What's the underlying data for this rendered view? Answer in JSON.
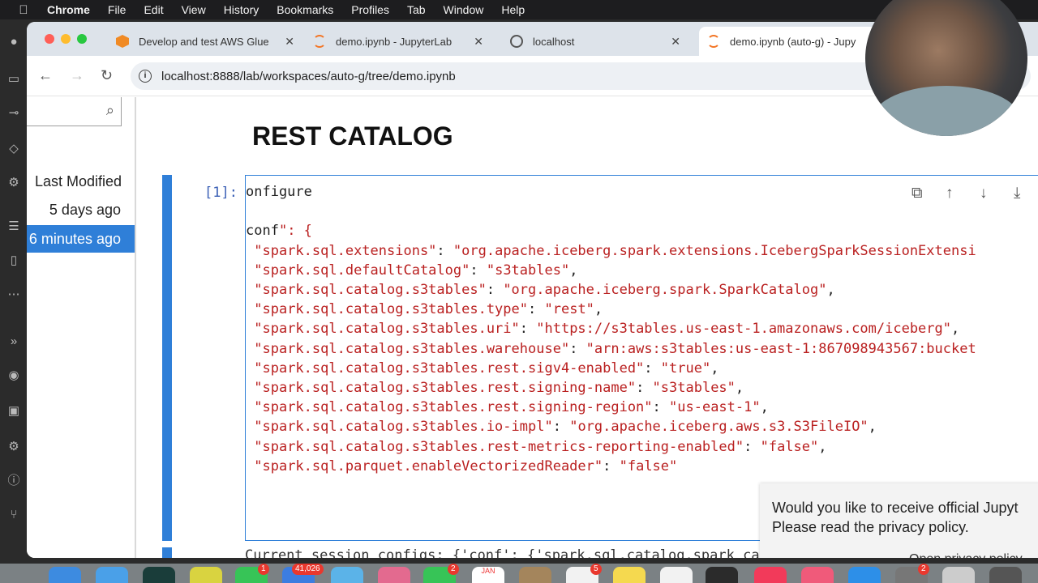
{
  "menubar": {
    "app_name": "Chrome",
    "items": [
      "File",
      "Edit",
      "View",
      "History",
      "Bookmarks",
      "Profiles",
      "Tab",
      "Window",
      "Help"
    ]
  },
  "browser": {
    "tabs": [
      {
        "title": "Develop and test AWS Glue",
        "icon": "aws-icon",
        "active": false
      },
      {
        "title": "demo.ipynb - JupyterLab",
        "icon": "jupyter-icon",
        "active": false
      },
      {
        "title": "localhost",
        "icon": "globe-icon",
        "active": false
      },
      {
        "title": "demo.ipynb (auto-g) - Jupy",
        "icon": "jupyter-icon",
        "active": true
      }
    ],
    "url": "localhost:8888/lab/workspaces/auto-g/tree/demo.ipynb"
  },
  "file_browser": {
    "column_header": "Last Modified",
    "rows": [
      {
        "modified": "5 days ago",
        "selected": false
      },
      {
        "modified": "6 minutes ago",
        "selected": true
      }
    ]
  },
  "notebook": {
    "markdown_title": "REST CATALOG",
    "cell_prompt": "[1]:",
    "code_lines": [
      "onfigure",
      "",
      "conf\": {",
      " \"spark.sql.extensions\": \"org.apache.iceberg.spark.extensions.IcebergSparkSessionExtensi",
      " \"spark.sql.defaultCatalog\": \"s3tables\",",
      " \"spark.sql.catalog.s3tables\": \"org.apache.iceberg.spark.SparkCatalog\",",
      " \"spark.sql.catalog.s3tables.type\": \"rest\",",
      " \"spark.sql.catalog.s3tables.uri\": \"https://s3tables.us-east-1.amazonaws.com/iceberg\",",
      " \"spark.sql.catalog.s3tables.warehouse\": \"arn:aws:s3tables:us-east-1:867098943567:bucket",
      " \"spark.sql.catalog.s3tables.rest.sigv4-enabled\": \"true\",",
      " \"spark.sql.catalog.s3tables.rest.signing-name\": \"s3tables\",",
      " \"spark.sql.catalog.s3tables.rest.signing-region\": \"us-east-1\",",
      " \"spark.sql.catalog.s3tables.io-impl\": \"org.apache.iceberg.aws.s3.S3FileIO\",",
      " \"spark.sql.catalog.s3tables.rest-metrics-reporting-enabled\": \"false\",",
      " \"spark.sql.parquet.enableVectorizedReader\": \"false\""
    ],
    "output_partial": "Current session configs: {'conf': {'spark.sql.catalog.spark_ca"
  },
  "toast": {
    "line1": "Would you like to receive official Jupyt",
    "line2": "Please read the privacy policy.",
    "link": "Open privacy policy"
  },
  "dock_badges": [
    "1",
    "41,026",
    "2",
    "5",
    "2"
  ],
  "dock_calendar_month": "JAN"
}
